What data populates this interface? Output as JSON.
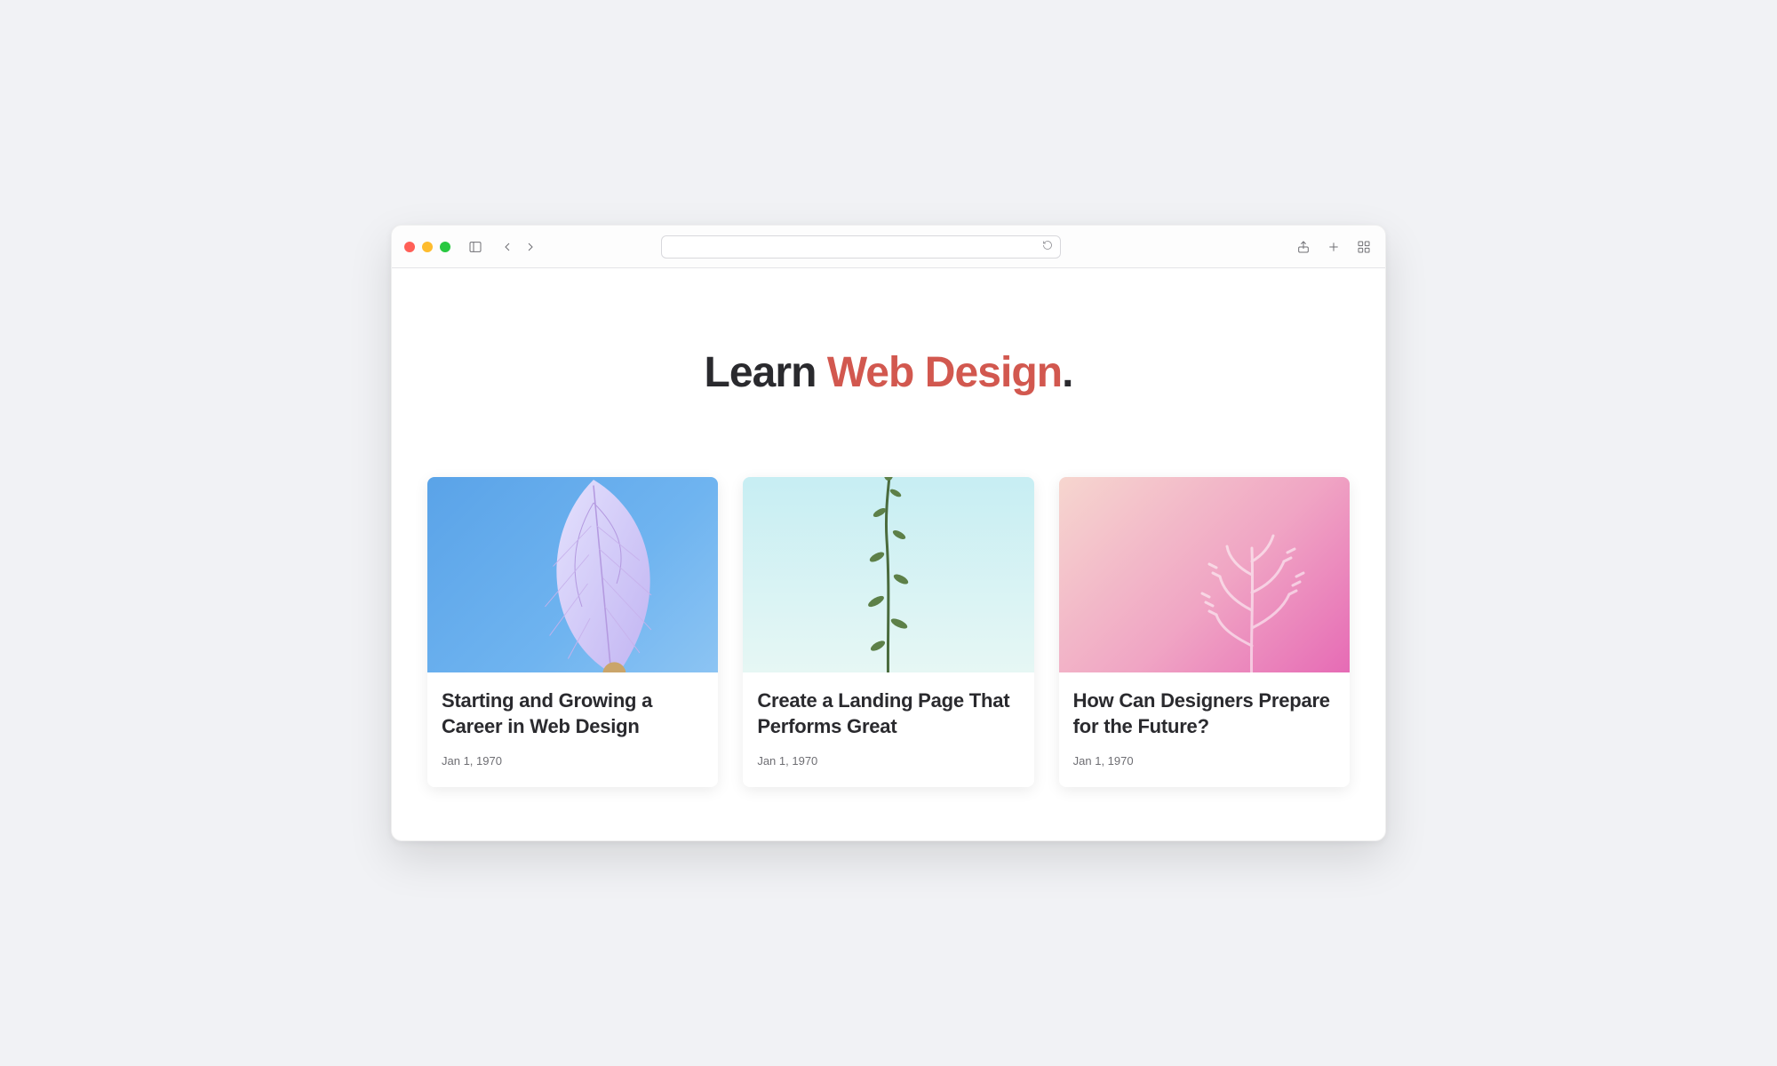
{
  "browser": {
    "url": ""
  },
  "hero": {
    "title_prefix": "Learn ",
    "title_accent": "Web Design",
    "title_suffix": "."
  },
  "cards": [
    {
      "title": "Starting and Growing a Career in Web Design",
      "date": "Jan 1, 1970"
    },
    {
      "title": "Create a Landing Page That Performs Great",
      "date": "Jan 1, 1970"
    },
    {
      "title": "How Can Designers Prepare for the Future?",
      "date": "Jan 1, 1970"
    }
  ],
  "colors": {
    "accent": "#d2584f",
    "text": "#2a2a2e",
    "muted": "#6e6e73"
  }
}
